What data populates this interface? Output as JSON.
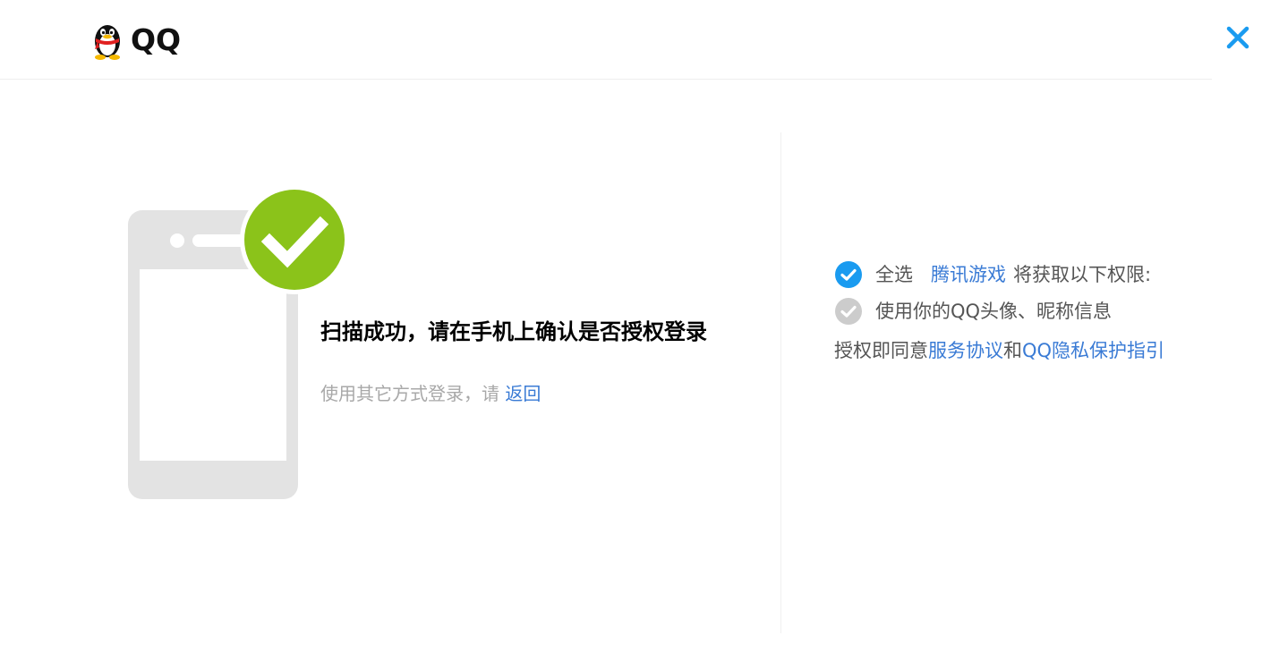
{
  "header": {
    "brand": "QQ",
    "logo_icon": "qq-penguin-icon",
    "close_icon": "close-icon",
    "close_color": "#1a9bf0"
  },
  "scan": {
    "title": "扫描成功，请在手机上确认是否授权登录",
    "alt_prefix": "使用其它方式登录，请",
    "back_link": "返回",
    "phone_icon": "phone-icon",
    "success_icon": "check-circle-icon",
    "success_color": "#8bc31a"
  },
  "permissions": {
    "select_all": "全选",
    "app_name": "腾讯游戏",
    "suffix": "将获取以下权限:",
    "item1": "使用你的QQ头像、昵称信息",
    "agree_prefix": "授权即同意",
    "service_link": "服务协议",
    "and": "和",
    "privacy_link": "QQ隐私保护指引",
    "checked_color": "#1a9bf0",
    "disabled_color": "#cccccc"
  }
}
